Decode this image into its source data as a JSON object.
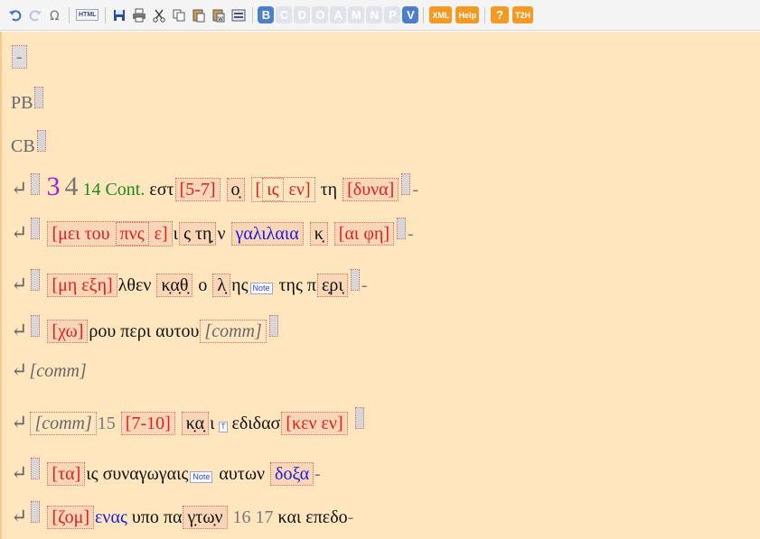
{
  "toolbar": {
    "icons": [
      "undo-icon",
      "redo-icon",
      "omega-icon",
      "html-label",
      "save-icon",
      "print-icon",
      "cut-icon",
      "copy-icon",
      "paste-icon",
      "paste-special-icon",
      "select-all-icon"
    ],
    "html_label": "HTML",
    "letters": [
      "B",
      "C",
      "D",
      "O",
      "A",
      "M",
      "N",
      "P",
      "V"
    ],
    "xml_label": "XML",
    "help_label": "Help",
    "question_label": "?",
    "t2h_label": "T2H",
    "colors": {
      "letter_on": "#4b7ecb",
      "letter_off": "#dfe3ea",
      "orange": "#f29a22"
    }
  },
  "editor": {
    "background": "#ffe6be",
    "return_symbol": "↵",
    "dash": "-",
    "line1": {
      "dash": "-"
    },
    "line2": {
      "tag": "PB"
    },
    "line3": {
      "tag": "CB"
    },
    "line4": {
      "n1": "3",
      "n2": "4",
      "n3": "14",
      "cont": "Cont.",
      "t1": "εστ",
      "b1": "[5-7]",
      "b2": "ο̣",
      "b3a": "[",
      "b3b": "ις",
      "b3c": "εν]",
      "t2": "τη",
      "b4": "[δυνα]",
      "dash": "-"
    },
    "line5": {
      "b1a": "[μει του",
      "b1b": "πνς",
      "b1c": "ε]",
      "t1": "ι",
      "b2": "ς τη̣",
      "t2": "ν",
      "b3": "γαλιλαια",
      "b4": "κ̣",
      "b5": "[αι φη]",
      "dash": "-"
    },
    "line6": {
      "b1": "[μη εξη]",
      "t1": "λθεν",
      "b2": "κ̣α̣θ̣",
      "t2": "ο",
      "b3": "λ̣",
      "t3": "ης",
      "note": "Note",
      "t4": "της π",
      "b4": "ε̣ρι̣",
      "dash": "-"
    },
    "line7": {
      "b1": "[χω]",
      "t1": "ρου περι αυτου",
      "comm": "[comm]"
    },
    "line8": {
      "comm": "[comm]"
    },
    "line9": {
      "comm": "[comm]",
      "n1": "15",
      "b1": "[7-10]",
      "b2": "κ̣α̣",
      "t1": "ι",
      "tsup": "T",
      "t2": "εδιδασ",
      "b3": "[κεν εν]"
    },
    "line10": {
      "b1": "[τα]",
      "t1": "ις συναγωγαις",
      "note": "Note",
      "t2": "αυτων",
      "b2": "δοξα",
      "dash": "-"
    },
    "line11": {
      "b1": "[ζομ]",
      "b2": "ενας",
      "t1": "υπο πα",
      "b3": "γ̣τω̣ν",
      "n1": "16",
      "n2": "17",
      "t2": "και επεδο",
      "dash": "-"
    }
  }
}
